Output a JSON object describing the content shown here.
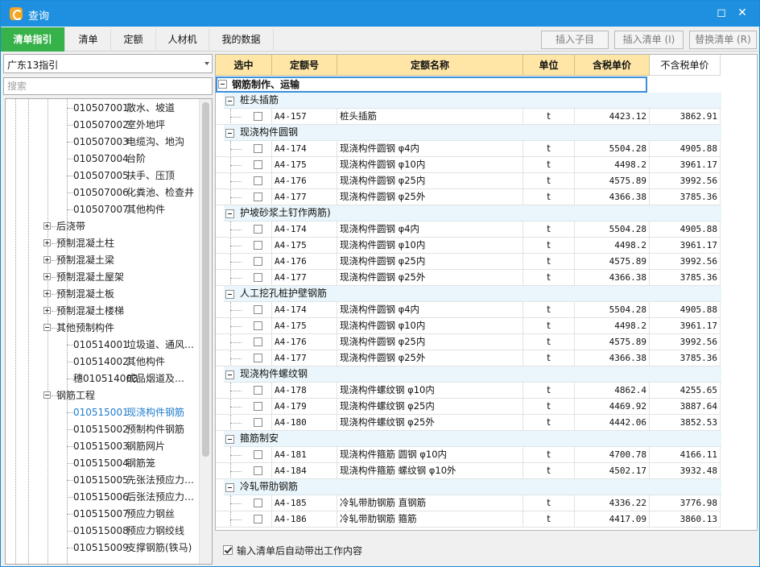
{
  "window": {
    "title": "查询"
  },
  "tabs": [
    {
      "label": "清单指引",
      "active": true
    },
    {
      "label": "清单"
    },
    {
      "label": "定额"
    },
    {
      "label": "人材机"
    },
    {
      "label": "我的数据"
    }
  ],
  "toolbar": {
    "insert_child": "插入子目",
    "insert_list": "插入清单 (I)",
    "replace_list": "替换清单 (R)"
  },
  "left": {
    "combo_value": "广东13指引",
    "search_placeholder": "搜索",
    "tree": [
      {
        "code": "010507001",
        "label": "散水、坡道",
        "level": 3
      },
      {
        "code": "010507002",
        "label": "室外地坪",
        "level": 3
      },
      {
        "code": "010507003",
        "label": "电缆沟、地沟",
        "level": 3
      },
      {
        "code": "010507004",
        "label": "台阶",
        "level": 3
      },
      {
        "code": "010507005",
        "label": "扶手、压顶",
        "level": 3
      },
      {
        "code": "010507006",
        "label": "化粪池、检查井",
        "level": 3
      },
      {
        "code": "010507007",
        "label": "其他构件",
        "level": 3
      },
      {
        "code": "",
        "label": "后浇带",
        "level": 2,
        "expander": "plus"
      },
      {
        "code": "",
        "label": "预制混凝土柱",
        "level": 2,
        "expander": "plus"
      },
      {
        "code": "",
        "label": "预制混凝土梁",
        "level": 2,
        "expander": "plus"
      },
      {
        "code": "",
        "label": "预制混凝土屋架",
        "level": 2,
        "expander": "plus"
      },
      {
        "code": "",
        "label": "预制混凝土板",
        "level": 2,
        "expander": "plus"
      },
      {
        "code": "",
        "label": "预制混凝土楼梯",
        "level": 2,
        "expander": "plus"
      },
      {
        "code": "",
        "label": "其他预制构件",
        "level": 2,
        "expander": "minus"
      },
      {
        "code": "010514001",
        "label": "垃圾道、通风…",
        "level": 3
      },
      {
        "code": "010514002",
        "label": "其他构件",
        "level": 3
      },
      {
        "code": "穗010514003",
        "label": "成品烟道及…",
        "level": 3
      },
      {
        "code": "",
        "label": "钢筋工程",
        "level": 2,
        "expander": "minus"
      },
      {
        "code": "010515001",
        "label": "现浇构件钢筋",
        "level": 3,
        "selected": true
      },
      {
        "code": "010515002",
        "label": "预制构件钢筋",
        "level": 3
      },
      {
        "code": "010515003",
        "label": "钢筋网片",
        "level": 3
      },
      {
        "code": "010515004",
        "label": "钢筋笼",
        "level": 3
      },
      {
        "code": "010515005",
        "label": "先张法预应力…",
        "level": 3
      },
      {
        "code": "010515006",
        "label": "后张法预应力…",
        "level": 3
      },
      {
        "code": "010515007",
        "label": "预应力钢丝",
        "level": 3
      },
      {
        "code": "010515008",
        "label": "预应力钢绞线",
        "level": 3
      },
      {
        "code": "010515009",
        "label": "支撑钢筋(铁马)",
        "level": 3
      }
    ]
  },
  "grid": {
    "headers": [
      "选中",
      "定额号",
      "定额名称",
      "单位",
      "含税单价",
      "不含税单价"
    ],
    "top_group": "钢筋制作、运输",
    "groups": [
      {
        "title": "桩头插筋",
        "rows": [
          {
            "code": "A4-157",
            "name": "桩头插筋",
            "unit": "t",
            "price": "4423.12",
            "price_ex": "3862.91"
          }
        ]
      },
      {
        "title": "现浇构件圆钢",
        "rows": [
          {
            "code": "A4-174",
            "name": "现浇构件圆钢 φ4内",
            "unit": "t",
            "price": "5504.28",
            "price_ex": "4905.88"
          },
          {
            "code": "A4-175",
            "name": "现浇构件圆钢 φ10内",
            "unit": "t",
            "price": "4498.2",
            "price_ex": "3961.17"
          },
          {
            "code": "A4-176",
            "name": "现浇构件圆钢 φ25内",
            "unit": "t",
            "price": "4575.89",
            "price_ex": "3992.56"
          },
          {
            "code": "A4-177",
            "name": "现浇构件圆钢 φ25外",
            "unit": "t",
            "price": "4366.38",
            "price_ex": "3785.36"
          }
        ]
      },
      {
        "title": "护坡砂浆土钉作两筋)",
        "rows": [
          {
            "code": "A4-174",
            "name": "现浇构件圆钢 φ4内",
            "unit": "t",
            "price": "5504.28",
            "price_ex": "4905.88"
          },
          {
            "code": "A4-175",
            "name": "现浇构件圆钢 φ10内",
            "unit": "t",
            "price": "4498.2",
            "price_ex": "3961.17"
          },
          {
            "code": "A4-176",
            "name": "现浇构件圆钢 φ25内",
            "unit": "t",
            "price": "4575.89",
            "price_ex": "3992.56"
          },
          {
            "code": "A4-177",
            "name": "现浇构件圆钢 φ25外",
            "unit": "t",
            "price": "4366.38",
            "price_ex": "3785.36"
          }
        ]
      },
      {
        "title": "人工挖孔桩护壁钢筋",
        "rows": [
          {
            "code": "A4-174",
            "name": "现浇构件圆钢 φ4内",
            "unit": "t",
            "price": "5504.28",
            "price_ex": "4905.88"
          },
          {
            "code": "A4-175",
            "name": "现浇构件圆钢 φ10内",
            "unit": "t",
            "price": "4498.2",
            "price_ex": "3961.17"
          },
          {
            "code": "A4-176",
            "name": "现浇构件圆钢 φ25内",
            "unit": "t",
            "price": "4575.89",
            "price_ex": "3992.56"
          },
          {
            "code": "A4-177",
            "name": "现浇构件圆钢 φ25外",
            "unit": "t",
            "price": "4366.38",
            "price_ex": "3785.36"
          }
        ]
      },
      {
        "title": "现浇构件螺纹钢",
        "rows": [
          {
            "code": "A4-178",
            "name": "现浇构件螺纹钢 φ10内",
            "unit": "t",
            "price": "4862.4",
            "price_ex": "4255.65"
          },
          {
            "code": "A4-179",
            "name": "现浇构件螺纹钢 φ25内",
            "unit": "t",
            "price": "4469.92",
            "price_ex": "3887.64"
          },
          {
            "code": "A4-180",
            "name": "现浇构件螺纹钢 φ25外",
            "unit": "t",
            "price": "4442.06",
            "price_ex": "3852.53"
          }
        ]
      },
      {
        "title": "箍筋制安",
        "rows": [
          {
            "code": "A4-181",
            "name": "现浇构件箍筋 圆钢 φ10内",
            "unit": "t",
            "price": "4700.78",
            "price_ex": "4166.11"
          },
          {
            "code": "A4-184",
            "name": "现浇构件箍筋 螺纹钢 φ10外",
            "unit": "t",
            "price": "4502.17",
            "price_ex": "3932.48"
          }
        ]
      },
      {
        "title": "冷轧带肋钢筋",
        "rows": [
          {
            "code": "A4-185",
            "name": "冷轧带肋钢筋 直钢筋",
            "unit": "t",
            "price": "4336.22",
            "price_ex": "3776.98"
          },
          {
            "code": "A4-186",
            "name": "冷轧带肋钢筋 箍筋",
            "unit": "t",
            "price": "4417.09",
            "price_ex": "3860.13"
          }
        ]
      }
    ]
  },
  "footer": {
    "auto_fill_label": "输入清单后自动带出工作内容",
    "auto_fill_checked": true
  },
  "colors": {
    "titlebar": "#1e90df",
    "active_tab": "#37b24a",
    "header": "#ffe6a6",
    "group_row": "#eaf6fb"
  }
}
